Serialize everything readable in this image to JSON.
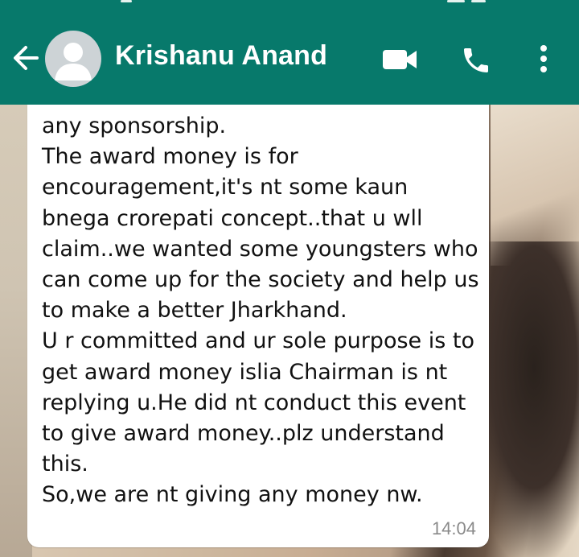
{
  "header": {
    "contact_name": "Krishanu Anand",
    "background_color": "#07796b",
    "icons": {
      "back": "arrow-back-icon",
      "avatar": "default-avatar-icon",
      "video": "video-call-icon",
      "voice": "phone-icon",
      "menu": "more-vert-icon"
    }
  },
  "message": {
    "text": "any sponsorship.\nThe award money is for encouragement,it's nt some kaun bnega crorepati concept..that u wll claim..we wanted some youngsters who can come up for the society and help us to make a better Jharkhand.\nU r committed and ur sole purpose is to get award money islia Chairman is nt replying u.He did nt conduct this event to give award money..plz understand this.\nSo,we are nt giving any money nw.",
    "time": "14:04"
  }
}
